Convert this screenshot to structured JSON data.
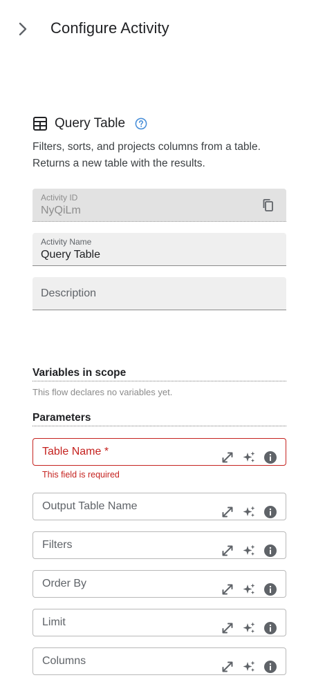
{
  "header": {
    "title": "Configure Activity",
    "collapse_icon": "chevron-right-icon"
  },
  "activity": {
    "icon": "table-icon",
    "title": "Query Table",
    "help_icon": "help-circle-icon",
    "description_line1": "Filters, sorts, and projects columns from a table.",
    "description_line2": "Returns a new table with the results."
  },
  "fields": {
    "activity_id": {
      "label": "Activity ID",
      "value": "NyQiLm",
      "icon": "copy-icon"
    },
    "activity_name": {
      "label": "Activity Name",
      "value": "Query Table"
    },
    "description": {
      "placeholder": "Description"
    }
  },
  "variables": {
    "title": "Variables in scope",
    "empty_text": "This flow declares no variables yet."
  },
  "parameters": {
    "title": "Parameters",
    "items": [
      {
        "label": "Table Name *",
        "required": true
      },
      {
        "label": "Output Table Name"
      },
      {
        "label": "Filters"
      },
      {
        "label": "Order By"
      },
      {
        "label": "Limit"
      },
      {
        "label": "Columns"
      }
    ],
    "error_text": "This field is required",
    "icons": [
      "expand-icon",
      "sparkle-icon",
      "info-icon"
    ]
  },
  "colors": {
    "error": "#c5221f",
    "help_accent": "#4a90d9",
    "field_bg": "#efefef",
    "field_readonly_bg": "#e2e2e2"
  }
}
